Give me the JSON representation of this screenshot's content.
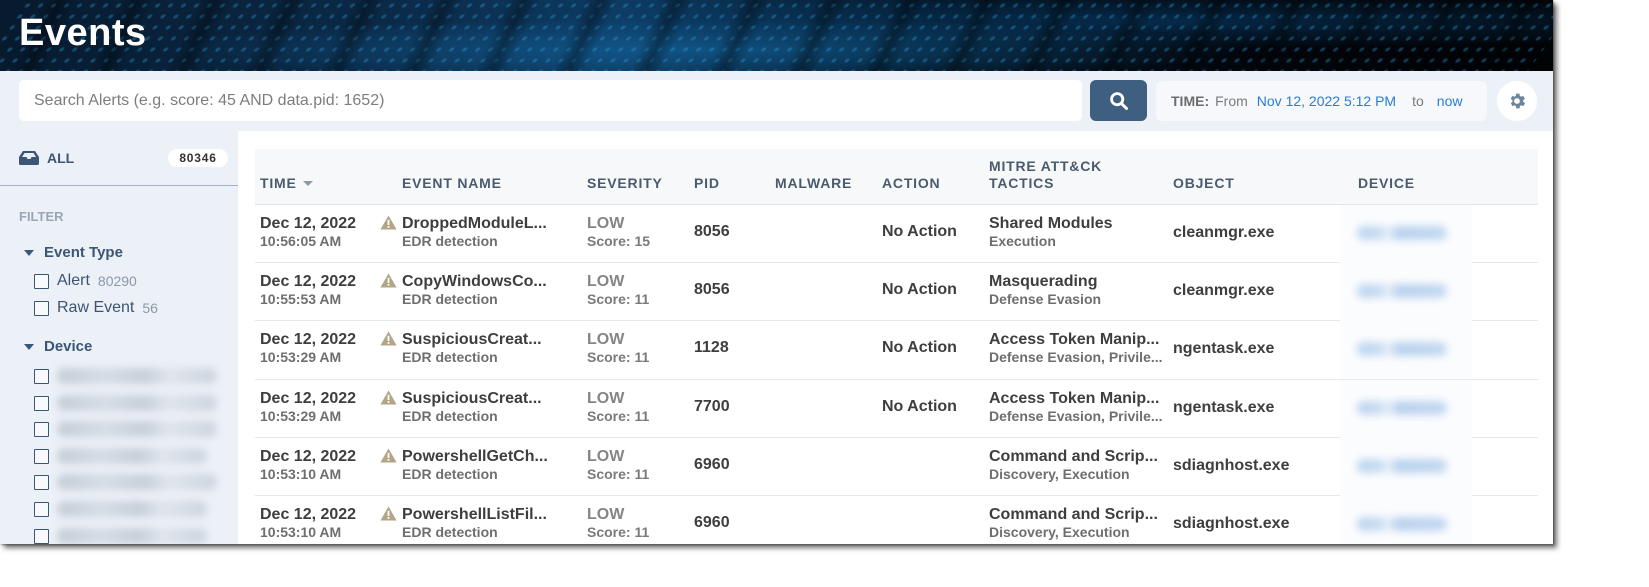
{
  "header": {
    "title": "Events"
  },
  "search": {
    "placeholder": "Search Alerts (e.g. score: 45 AND data.pid: 1652)",
    "value": "",
    "button_icon": "search-icon"
  },
  "time_range": {
    "label": "TIME:",
    "from_word": "From",
    "from_value": "Nov 12, 2022 5:12 PM",
    "to_word": "to",
    "to_value": "now"
  },
  "settings": {
    "icon": "gear-icon"
  },
  "sidebar": {
    "all": {
      "icon": "inbox-icon",
      "label": "ALL",
      "count": "80346"
    },
    "filter_heading": "FILTER",
    "groups": [
      {
        "title": "Event Type",
        "expanded": true,
        "options": [
          {
            "label": "Alert",
            "count": "80290",
            "checked": false
          },
          {
            "label": "Raw Event",
            "count": "56",
            "checked": false
          }
        ]
      },
      {
        "title": "Device",
        "expanded": true,
        "options_redacted": true,
        "visible_option_count": 7
      }
    ]
  },
  "table": {
    "columns": [
      {
        "key": "time",
        "label": "TIME",
        "sorted": "desc"
      },
      {
        "key": "event_name",
        "label": "EVENT NAME"
      },
      {
        "key": "severity",
        "label": "SEVERITY"
      },
      {
        "key": "pid",
        "label": "PID"
      },
      {
        "key": "malware",
        "label": "MALWARE"
      },
      {
        "key": "action",
        "label": "ACTION"
      },
      {
        "key": "mitre",
        "label": "MITRE ATT&CK TACTICS"
      },
      {
        "key": "object",
        "label": "OBJECT"
      },
      {
        "key": "device",
        "label": "DEVICE"
      }
    ],
    "rows": [
      {
        "date": "Dec 12, 2022",
        "time": "10:56:05 AM",
        "event_icon": "warning-icon",
        "event_name": "DroppedModuleL...",
        "event_type": "EDR detection",
        "severity": "LOW",
        "score": "Score: 15",
        "pid": "8056",
        "malware": "",
        "action": "No Action",
        "technique": "Shared Modules",
        "tactics": "Execution",
        "object": "cleanmgr.exe",
        "device_redacted": true
      },
      {
        "date": "Dec 12, 2022",
        "time": "10:55:53 AM",
        "event_icon": "warning-icon",
        "event_name": "CopyWindowsCo...",
        "event_type": "EDR detection",
        "severity": "LOW",
        "score": "Score: 11",
        "pid": "8056",
        "malware": "",
        "action": "No Action",
        "technique": "Masquerading",
        "tactics": "Defense Evasion",
        "object": "cleanmgr.exe",
        "device_redacted": true
      },
      {
        "date": "Dec 12, 2022",
        "time": "10:53:29 AM",
        "event_icon": "warning-icon",
        "event_name": "SuspiciousCreat...",
        "event_type": "EDR detection",
        "severity": "LOW",
        "score": "Score: 11",
        "pid": "1128",
        "malware": "",
        "action": "No Action",
        "technique": "Access Token Manip...",
        "tactics": "Defense Evasion, Privile...",
        "object": "ngentask.exe",
        "device_redacted": true
      },
      {
        "date": "Dec 12, 2022",
        "time": "10:53:29 AM",
        "event_icon": "warning-icon",
        "event_name": "SuspiciousCreat...",
        "event_type": "EDR detection",
        "severity": "LOW",
        "score": "Score: 11",
        "pid": "7700",
        "malware": "",
        "action": "No Action",
        "technique": "Access Token Manip...",
        "tactics": "Defense Evasion, Privile...",
        "object": "ngentask.exe",
        "device_redacted": true
      },
      {
        "date": "Dec 12, 2022",
        "time": "10:53:10 AM",
        "event_icon": "warning-icon",
        "event_name": "PowershellGetCh...",
        "event_type": "EDR detection",
        "severity": "LOW",
        "score": "Score: 11",
        "pid": "6960",
        "malware": "",
        "action": "",
        "technique": "Command and Scrip...",
        "tactics": "Discovery, Execution",
        "object": "sdiagnhost.exe",
        "device_redacted": true
      },
      {
        "date": "Dec 12, 2022",
        "time": "10:53:10 AM",
        "event_icon": "warning-icon",
        "event_name": "PowershellListFil...",
        "event_type": "EDR detection",
        "severity": "LOW",
        "score": "Score: 11",
        "pid": "6960",
        "malware": "",
        "action": "",
        "technique": "Command and Scrip...",
        "tactics": "Discovery, Execution",
        "object": "sdiagnhost.exe",
        "device_redacted": true
      }
    ]
  },
  "colors": {
    "accent": "#3e5f80",
    "link": "#2b7bd6",
    "warning_icon": "#b3a587",
    "sidebar_bg": "#ecf1f8"
  }
}
